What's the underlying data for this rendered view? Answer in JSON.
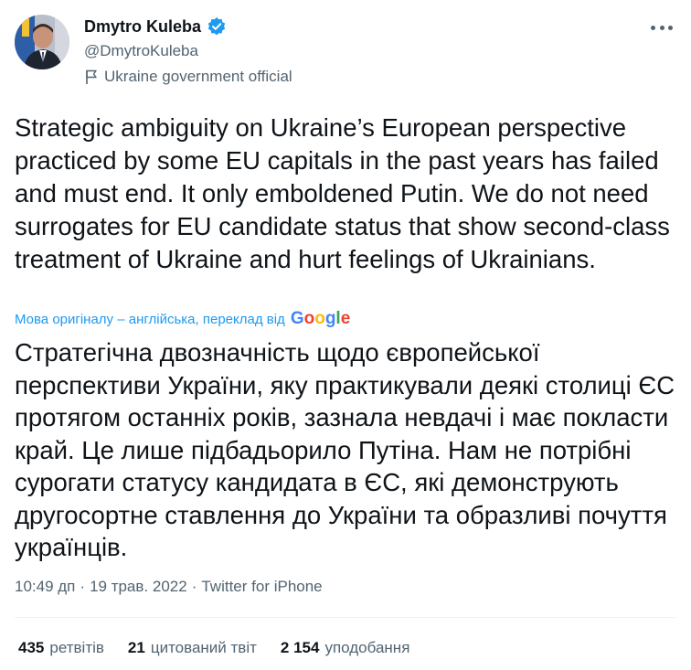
{
  "author": {
    "display_name": "Dmytro Kuleba",
    "handle": "@DmytroKuleba",
    "label": "Ukraine government official",
    "verified": true
  },
  "tweet": {
    "text": "Strategic ambiguity on Ukraine’s European perspective practiced by some EU capitals in the past years has failed and must end. It only emboldened Putin. We do not need surrogates for EU candidate status that show second-class treatment of Ukraine and hurt feelings of Ukrainians.",
    "translation_note": "Мова оригіналу – англійська, переклад від",
    "translation_provider": "Google",
    "translated_text": "Стратегічна двозначність щодо європейської перспективи України, яку практикували деякі столиці ЄС протягом останніх років, зазнала невдачі і має покласти край. Це лише підбадьорило Путіна. Нам не потрібні сурогати статусу кандидата в ЄС, які демонструють другосортне ставлення до України та образливі почуття українців.",
    "time": "10:49 дп",
    "date": "19 трав. 2022",
    "source": "Twitter for iPhone",
    "separator": "·"
  },
  "stats": [
    {
      "count": "435",
      "label": "ретвітів"
    },
    {
      "count": "21",
      "label": "цитований твіт"
    },
    {
      "count": "2 154",
      "label": "уподобання"
    }
  ],
  "icons": {
    "verified": "verified-badge-icon",
    "label": "flag-icon",
    "more": "more-options-icon"
  },
  "colors": {
    "text": "#0f1419",
    "secondary": "#536471",
    "accent": "#1d9bf0",
    "divider": "#eff3f4"
  }
}
